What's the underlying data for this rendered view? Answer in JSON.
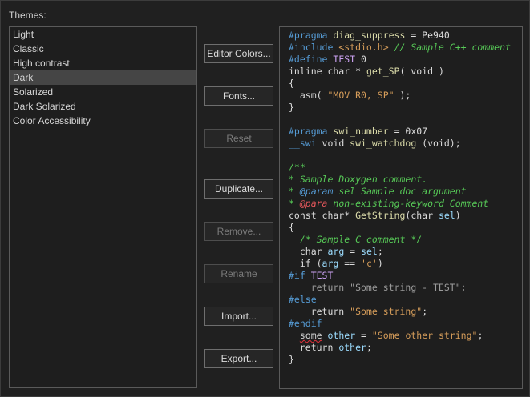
{
  "themes_label": "Themes:",
  "themes": [
    {
      "label": "Light",
      "selected": false
    },
    {
      "label": "Classic",
      "selected": false
    },
    {
      "label": "High contrast",
      "selected": false
    },
    {
      "label": "Dark",
      "selected": true
    },
    {
      "label": "Solarized",
      "selected": false
    },
    {
      "label": "Dark Solarized",
      "selected": false
    },
    {
      "label": "Color Accessibility",
      "selected": false
    }
  ],
  "buttons": {
    "editor_colors": "Editor Colors...",
    "fonts": "Fonts...",
    "reset": "Reset",
    "duplicate": "Duplicate...",
    "remove": "Remove...",
    "rename": "Rename",
    "import": "Import...",
    "export": "Export..."
  },
  "colors": {
    "background": "#202020",
    "keyword": "#569cd6",
    "function": "#dcdcaa",
    "string": "#d69d5a",
    "comment": "#57c957",
    "doc_error": "#e2565b",
    "variable": "#9cdcfe"
  },
  "code_lines": [
    [
      [
        "pp",
        "#pragma "
      ],
      [
        "fn",
        "diag_suppress"
      ],
      [
        "plain",
        " = Pe940"
      ]
    ],
    [
      [
        "pp",
        "#include "
      ],
      [
        "str",
        "<stdio.h>"
      ],
      [
        "cmt",
        " // Sample C++ comment"
      ]
    ],
    [
      [
        "pp",
        "#define "
      ],
      [
        "macro",
        "TEST"
      ],
      [
        "plain",
        " 0"
      ]
    ],
    [
      [
        "plain",
        "inline char * "
      ],
      [
        "fn",
        "get_SP"
      ],
      [
        "plain",
        "( void )"
      ]
    ],
    [
      [
        "plain",
        "{"
      ]
    ],
    [
      [
        "plain",
        "  asm( "
      ],
      [
        "str",
        "\"MOV R0, SP\""
      ],
      [
        "plain",
        " );"
      ]
    ],
    [
      [
        "plain",
        "}"
      ]
    ],
    [],
    [
      [
        "pp",
        "#pragma "
      ],
      [
        "fn",
        "swi_number"
      ],
      [
        "plain",
        " = 0x07"
      ]
    ],
    [
      [
        "kw",
        "__swi"
      ],
      [
        "plain",
        " void "
      ],
      [
        "fn",
        "swi_watchdog"
      ],
      [
        "plain",
        " (void);"
      ]
    ],
    [],
    [
      [
        "cmt",
        "/**"
      ]
    ],
    [
      [
        "cmt",
        "* Sample Doxygen comment."
      ]
    ],
    [
      [
        "cmt",
        "* "
      ],
      [
        "doctag",
        "@param"
      ],
      [
        "cmt",
        " sel Sample doc argument"
      ]
    ],
    [
      [
        "cmt",
        "* "
      ],
      [
        "docbad",
        "@para"
      ],
      [
        "cmt",
        " non-existing-keyword Comment"
      ]
    ],
    [
      [
        "plain",
        "const char* "
      ],
      [
        "fn",
        "GetString"
      ],
      [
        "plain",
        "(char "
      ],
      [
        "var",
        "sel"
      ],
      [
        "plain",
        ")"
      ]
    ],
    [
      [
        "plain",
        "{"
      ]
    ],
    [
      [
        "cmt",
        "  /* Sample C comment */"
      ]
    ],
    [
      [
        "plain",
        "  char "
      ],
      [
        "var",
        "arg"
      ],
      [
        "plain",
        " = "
      ],
      [
        "var",
        "sel"
      ],
      [
        "plain",
        ";"
      ]
    ],
    [
      [
        "plain",
        "  if ("
      ],
      [
        "var",
        "arg"
      ],
      [
        "plain",
        " == "
      ],
      [
        "str",
        "'c'"
      ],
      [
        "plain",
        ")"
      ]
    ],
    [
      [
        "pp",
        "#if "
      ],
      [
        "macro",
        "TEST"
      ]
    ],
    [
      [
        "dim",
        "    return \"Some string - TEST\";"
      ]
    ],
    [
      [
        "pp",
        "#else"
      ]
    ],
    [
      [
        "plain",
        "    return "
      ],
      [
        "str",
        "\"Some string\""
      ],
      [
        "plain",
        ";"
      ]
    ],
    [
      [
        "pp",
        "#endif"
      ]
    ],
    [
      [
        "plain",
        "  "
      ],
      [
        "squiggle",
        "some"
      ],
      [
        "plain",
        " "
      ],
      [
        "var",
        "other"
      ],
      [
        "plain",
        " = "
      ],
      [
        "str",
        "\"Some other string\""
      ],
      [
        "plain",
        ";"
      ]
    ],
    [
      [
        "plain",
        "  return "
      ],
      [
        "var",
        "other"
      ],
      [
        "plain",
        ";"
      ]
    ],
    [
      [
        "plain",
        "}"
      ]
    ]
  ]
}
